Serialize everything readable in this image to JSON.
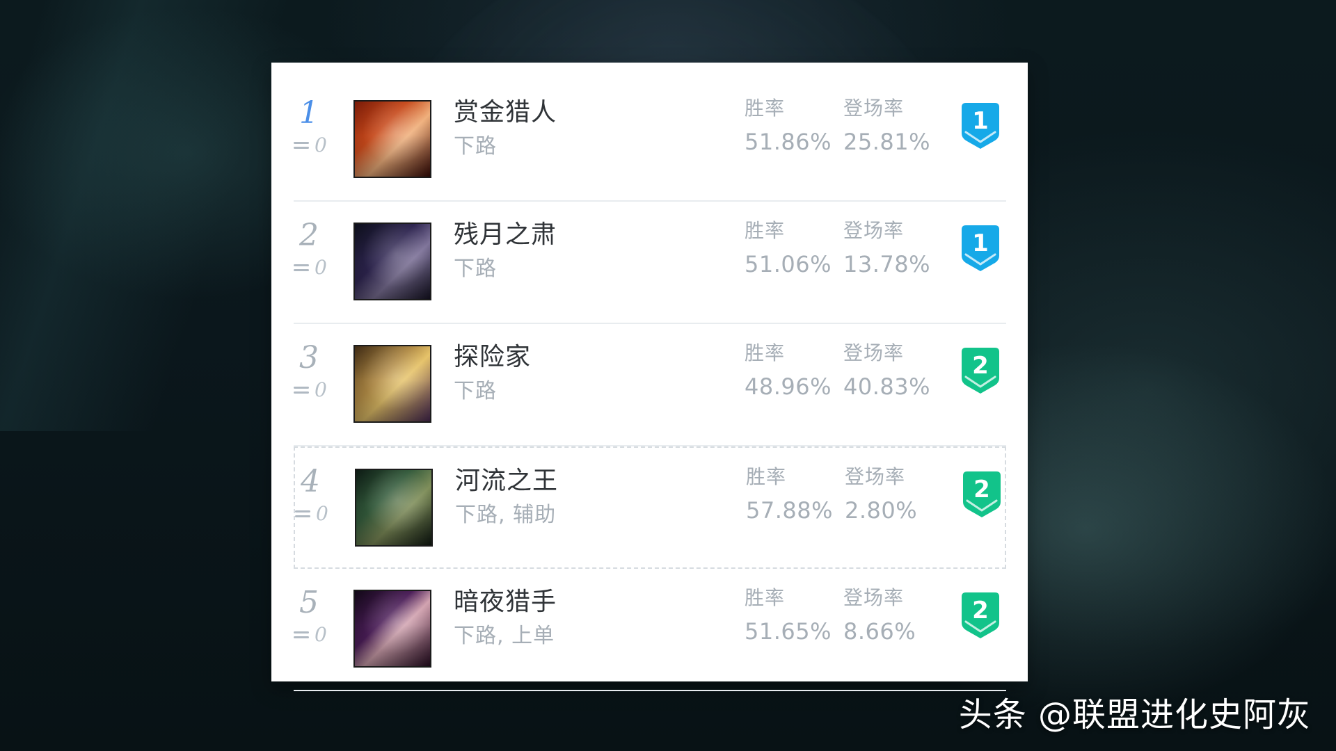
{
  "list": {
    "rows": [
      {
        "rank": "1",
        "rank_style": "first",
        "change": "0",
        "name": "赏金猎人",
        "lane": "下路",
        "win_label": "胜率",
        "win_value": "51.86%",
        "pick_label": "登场率",
        "pick_value": "25.81%",
        "tier": "1",
        "tier_color": "#16a9e8",
        "portrait_icon": "champion-portrait-icon"
      },
      {
        "rank": "2",
        "rank_style": "normal",
        "change": "0",
        "name": "残月之肃",
        "lane": "下路",
        "win_label": "胜率",
        "win_value": "51.06%",
        "pick_label": "登场率",
        "pick_value": "13.78%",
        "tier": "1",
        "tier_color": "#16a9e8",
        "portrait_icon": "champion-portrait-icon"
      },
      {
        "rank": "3",
        "rank_style": "normal",
        "change": "0",
        "name": "探险家",
        "lane": "下路",
        "win_label": "胜率",
        "win_value": "48.96%",
        "pick_label": "登场率",
        "pick_value": "40.83%",
        "tier": "2",
        "tier_color": "#12c38a",
        "portrait_icon": "champion-portrait-icon"
      },
      {
        "rank": "4",
        "rank_style": "normal",
        "change": "0",
        "name": "河流之王",
        "lane": "下路, 辅助",
        "win_label": "胜率",
        "win_value": "57.88%",
        "pick_label": "登场率",
        "pick_value": "2.80%",
        "tier": "2",
        "tier_color": "#12c38a",
        "portrait_icon": "champion-portrait-icon"
      },
      {
        "rank": "5",
        "rank_style": "normal",
        "change": "0",
        "name": "暗夜猎手",
        "lane": "下路, 上单",
        "win_label": "胜率",
        "win_value": "51.65%",
        "pick_label": "登场率",
        "pick_value": "8.66%",
        "tier": "2",
        "tier_color": "#12c38a",
        "portrait_icon": "champion-portrait-icon"
      }
    ]
  },
  "watermark": {
    "text": "头条 @联盟进化史阿灰"
  },
  "icons": {
    "rank_change": "equals-icon",
    "tier_badge": "tier-badge-icon"
  }
}
